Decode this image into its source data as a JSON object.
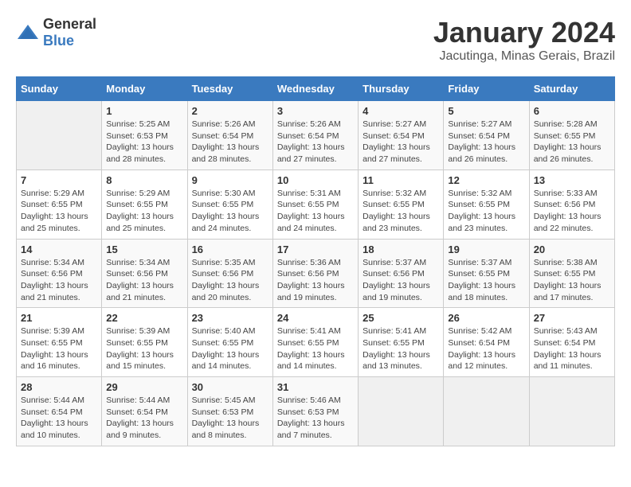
{
  "header": {
    "logo_general": "General",
    "logo_blue": "Blue",
    "month_title": "January 2024",
    "location": "Jacutinga, Minas Gerais, Brazil"
  },
  "weekdays": [
    "Sunday",
    "Monday",
    "Tuesday",
    "Wednesday",
    "Thursday",
    "Friday",
    "Saturday"
  ],
  "weeks": [
    [
      {
        "day": "",
        "info": ""
      },
      {
        "day": "1",
        "info": "Sunrise: 5:25 AM\nSunset: 6:53 PM\nDaylight: 13 hours\nand 28 minutes."
      },
      {
        "day": "2",
        "info": "Sunrise: 5:26 AM\nSunset: 6:54 PM\nDaylight: 13 hours\nand 28 minutes."
      },
      {
        "day": "3",
        "info": "Sunrise: 5:26 AM\nSunset: 6:54 PM\nDaylight: 13 hours\nand 27 minutes."
      },
      {
        "day": "4",
        "info": "Sunrise: 5:27 AM\nSunset: 6:54 PM\nDaylight: 13 hours\nand 27 minutes."
      },
      {
        "day": "5",
        "info": "Sunrise: 5:27 AM\nSunset: 6:54 PM\nDaylight: 13 hours\nand 26 minutes."
      },
      {
        "day": "6",
        "info": "Sunrise: 5:28 AM\nSunset: 6:55 PM\nDaylight: 13 hours\nand 26 minutes."
      }
    ],
    [
      {
        "day": "7",
        "info": "Sunrise: 5:29 AM\nSunset: 6:55 PM\nDaylight: 13 hours\nand 25 minutes."
      },
      {
        "day": "8",
        "info": "Sunrise: 5:29 AM\nSunset: 6:55 PM\nDaylight: 13 hours\nand 25 minutes."
      },
      {
        "day": "9",
        "info": "Sunrise: 5:30 AM\nSunset: 6:55 PM\nDaylight: 13 hours\nand 24 minutes."
      },
      {
        "day": "10",
        "info": "Sunrise: 5:31 AM\nSunset: 6:55 PM\nDaylight: 13 hours\nand 24 minutes."
      },
      {
        "day": "11",
        "info": "Sunrise: 5:32 AM\nSunset: 6:55 PM\nDaylight: 13 hours\nand 23 minutes."
      },
      {
        "day": "12",
        "info": "Sunrise: 5:32 AM\nSunset: 6:55 PM\nDaylight: 13 hours\nand 23 minutes."
      },
      {
        "day": "13",
        "info": "Sunrise: 5:33 AM\nSunset: 6:56 PM\nDaylight: 13 hours\nand 22 minutes."
      }
    ],
    [
      {
        "day": "14",
        "info": "Sunrise: 5:34 AM\nSunset: 6:56 PM\nDaylight: 13 hours\nand 21 minutes."
      },
      {
        "day": "15",
        "info": "Sunrise: 5:34 AM\nSunset: 6:56 PM\nDaylight: 13 hours\nand 21 minutes."
      },
      {
        "day": "16",
        "info": "Sunrise: 5:35 AM\nSunset: 6:56 PM\nDaylight: 13 hours\nand 20 minutes."
      },
      {
        "day": "17",
        "info": "Sunrise: 5:36 AM\nSunset: 6:56 PM\nDaylight: 13 hours\nand 19 minutes."
      },
      {
        "day": "18",
        "info": "Sunrise: 5:37 AM\nSunset: 6:56 PM\nDaylight: 13 hours\nand 19 minutes."
      },
      {
        "day": "19",
        "info": "Sunrise: 5:37 AM\nSunset: 6:55 PM\nDaylight: 13 hours\nand 18 minutes."
      },
      {
        "day": "20",
        "info": "Sunrise: 5:38 AM\nSunset: 6:55 PM\nDaylight: 13 hours\nand 17 minutes."
      }
    ],
    [
      {
        "day": "21",
        "info": "Sunrise: 5:39 AM\nSunset: 6:55 PM\nDaylight: 13 hours\nand 16 minutes."
      },
      {
        "day": "22",
        "info": "Sunrise: 5:39 AM\nSunset: 6:55 PM\nDaylight: 13 hours\nand 15 minutes."
      },
      {
        "day": "23",
        "info": "Sunrise: 5:40 AM\nSunset: 6:55 PM\nDaylight: 13 hours\nand 14 minutes."
      },
      {
        "day": "24",
        "info": "Sunrise: 5:41 AM\nSunset: 6:55 PM\nDaylight: 13 hours\nand 14 minutes."
      },
      {
        "day": "25",
        "info": "Sunrise: 5:41 AM\nSunset: 6:55 PM\nDaylight: 13 hours\nand 13 minutes."
      },
      {
        "day": "26",
        "info": "Sunrise: 5:42 AM\nSunset: 6:54 PM\nDaylight: 13 hours\nand 12 minutes."
      },
      {
        "day": "27",
        "info": "Sunrise: 5:43 AM\nSunset: 6:54 PM\nDaylight: 13 hours\nand 11 minutes."
      }
    ],
    [
      {
        "day": "28",
        "info": "Sunrise: 5:44 AM\nSunset: 6:54 PM\nDaylight: 13 hours\nand 10 minutes."
      },
      {
        "day": "29",
        "info": "Sunrise: 5:44 AM\nSunset: 6:54 PM\nDaylight: 13 hours\nand 9 minutes."
      },
      {
        "day": "30",
        "info": "Sunrise: 5:45 AM\nSunset: 6:53 PM\nDaylight: 13 hours\nand 8 minutes."
      },
      {
        "day": "31",
        "info": "Sunrise: 5:46 AM\nSunset: 6:53 PM\nDaylight: 13 hours\nand 7 minutes."
      },
      {
        "day": "",
        "info": ""
      },
      {
        "day": "",
        "info": ""
      },
      {
        "day": "",
        "info": ""
      }
    ]
  ]
}
